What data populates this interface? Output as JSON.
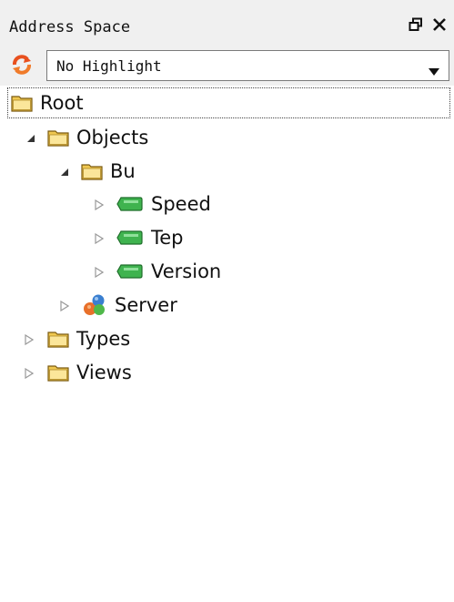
{
  "panel": {
    "title": "Address Space",
    "restore_icon": "restore-icon",
    "close_icon": "close-icon"
  },
  "toolbar": {
    "refresh_icon": "refresh-icon",
    "highlight_value": "No Highlight"
  },
  "tree": {
    "root": "Root",
    "objects": "Objects",
    "bu": "Bu",
    "speed": "Speed",
    "tep": "Tep",
    "version": "Version",
    "server": "Server",
    "types": "Types",
    "views": "Views"
  },
  "colors": {
    "folder": "#f0c850",
    "variable": "#3fb34f",
    "refresh": "#e8501e"
  }
}
